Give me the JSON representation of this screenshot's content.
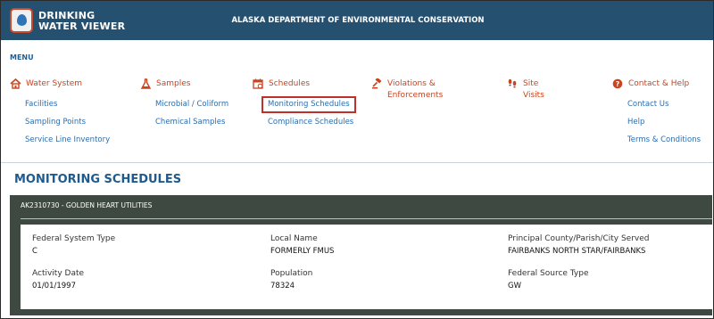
{
  "header": {
    "app_name_line1": "DRINKING",
    "app_name_line2": "WATER VIEWER",
    "department": "ALASKA DEPARTMENT OF ENVIRONMENTAL CONSERVATION",
    "background_color": "#25506f"
  },
  "menu": {
    "title": "MENU",
    "accent_color": "#c8431f",
    "link_color": "#2a6db0",
    "columns": [
      {
        "icon": "house-icon",
        "label": "Water System",
        "links": [
          "Facilities",
          "Sampling Points",
          "Service Line Inventory"
        ]
      },
      {
        "icon": "flask-icon",
        "label": "Samples",
        "links": [
          "Microbial / Coliform",
          "Chemical Samples"
        ]
      },
      {
        "icon": "calendar-icon",
        "label": "Schedules",
        "links": [
          "Monitoring Schedules",
          "Compliance Schedules"
        ],
        "active_link": "Monitoring Schedules"
      },
      {
        "icon": "gavel-icon",
        "label_line1": "Violations &",
        "label_line2": "Enforcements",
        "links": []
      },
      {
        "icon": "footprints-icon",
        "label_line1": "Site",
        "label_line2": "Visits",
        "links": []
      },
      {
        "icon": "help-icon",
        "label": "Contact & Help",
        "links": [
          "Contact Us",
          "Help",
          "Terms & Conditions"
        ]
      }
    ]
  },
  "page": {
    "title": "MONITORING SCHEDULES"
  },
  "system": {
    "title": "AK2310730 - GOLDEN HEART UTILITIES",
    "fields": {
      "federal_system_type": {
        "label": "Federal System Type",
        "value": "C"
      },
      "local_name": {
        "label": "Local Name",
        "value": "FORMERLY FMUS"
      },
      "principal_county": {
        "label": "Principal County/Parish/City Served",
        "value": "FAIRBANKS NORTH STAR/FAIRBANKS"
      },
      "activity_date": {
        "label": "Activity Date",
        "value": "01/01/1997"
      },
      "population": {
        "label": "Population",
        "value": "78324"
      },
      "federal_source_type": {
        "label": "Federal Source Type",
        "value": "GW"
      }
    }
  }
}
